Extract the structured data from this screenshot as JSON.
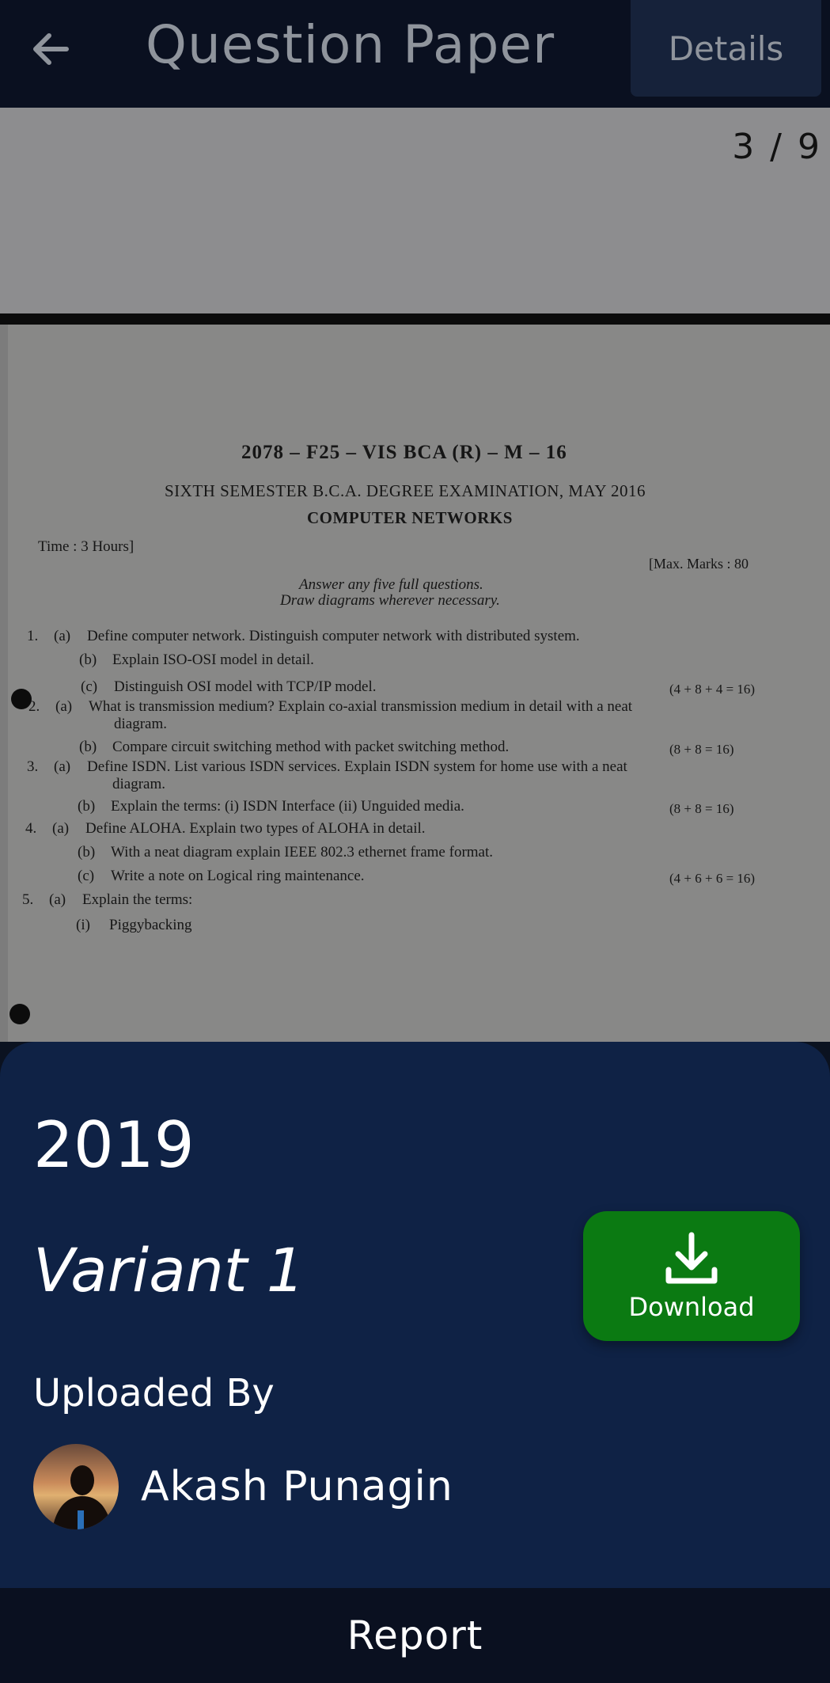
{
  "appbar": {
    "back_icon": "arrow-left-icon",
    "title": "Question Paper",
    "details_label": "Details"
  },
  "viewer": {
    "page_counter": "3 / 9",
    "paper": {
      "code": "2078 – F25 – VIS BCA (R) – M – 16",
      "semester": "SIXTH SEMESTER B.C.A. DEGREE EXAMINATION, MAY 2016",
      "subject": "COMPUTER NETWORKS",
      "time": "Time : 3 Hours]",
      "max_marks": "[Max. Marks : 80",
      "instruction_1": "Answer any five full questions.",
      "instruction_2": "Draw diagrams wherever necessary.",
      "questions": [
        {
          "num": "1.",
          "part": "(a)",
          "text": "Define computer network. Distinguish computer network with distributed system.",
          "marks": ""
        },
        {
          "num": "",
          "part": "(b)",
          "text": "Explain ISO-OSI model in detail.",
          "marks": ""
        },
        {
          "num": "",
          "part": "(c)",
          "text": "Distinguish OSI model with TCP/IP model.",
          "marks": "(4 + 8 + 4 = 16)"
        },
        {
          "num": "2.",
          "part": "(a)",
          "text": "What is transmission medium? Explain co-axial transmission medium in detail with a neat",
          "marks": ""
        },
        {
          "num": "",
          "part": "",
          "text": "diagram.",
          "marks": ""
        },
        {
          "num": "",
          "part": "(b)",
          "text": "Compare circuit switching method with packet switching method.",
          "marks": "(8 + 8 = 16)"
        },
        {
          "num": "3.",
          "part": "(a)",
          "text": "Define ISDN. List various ISDN services. Explain ISDN system for home use with a neat",
          "marks": ""
        },
        {
          "num": "",
          "part": "",
          "text": "diagram.",
          "marks": ""
        },
        {
          "num": "",
          "part": "(b)",
          "text": "Explain the terms: (i) ISDN Interface (ii) Unguided media.",
          "marks": "(8 + 8 = 16)"
        },
        {
          "num": "4.",
          "part": "(a)",
          "text": "Define ALOHA. Explain two types of ALOHA in detail.",
          "marks": ""
        },
        {
          "num": "",
          "part": "(b)",
          "text": "With a neat diagram explain IEEE 802.3 ethernet frame format.",
          "marks": ""
        },
        {
          "num": "",
          "part": "(c)",
          "text": "Write a note on Logical ring maintenance.",
          "marks": "(4 + 6 + 6 = 16)"
        },
        {
          "num": "5.",
          "part": "(a)",
          "text": "Explain the terms:",
          "marks": ""
        },
        {
          "num": "",
          "part": "(i)",
          "text": "Piggybacking",
          "marks": ""
        }
      ]
    }
  },
  "sheet": {
    "year": "2019",
    "variant": "Variant 1",
    "download_icon": "download-icon",
    "download_label": "Download",
    "uploaded_by_label": "Uploaded By",
    "uploader_name": "Akash Punagin"
  },
  "footer": {
    "report_label": "Report"
  },
  "colors": {
    "appbar_bg": "#0a1020",
    "sheet_bg": "#0f2245",
    "download_bg": "#0b7a12",
    "muted_text": "#8f949c"
  }
}
